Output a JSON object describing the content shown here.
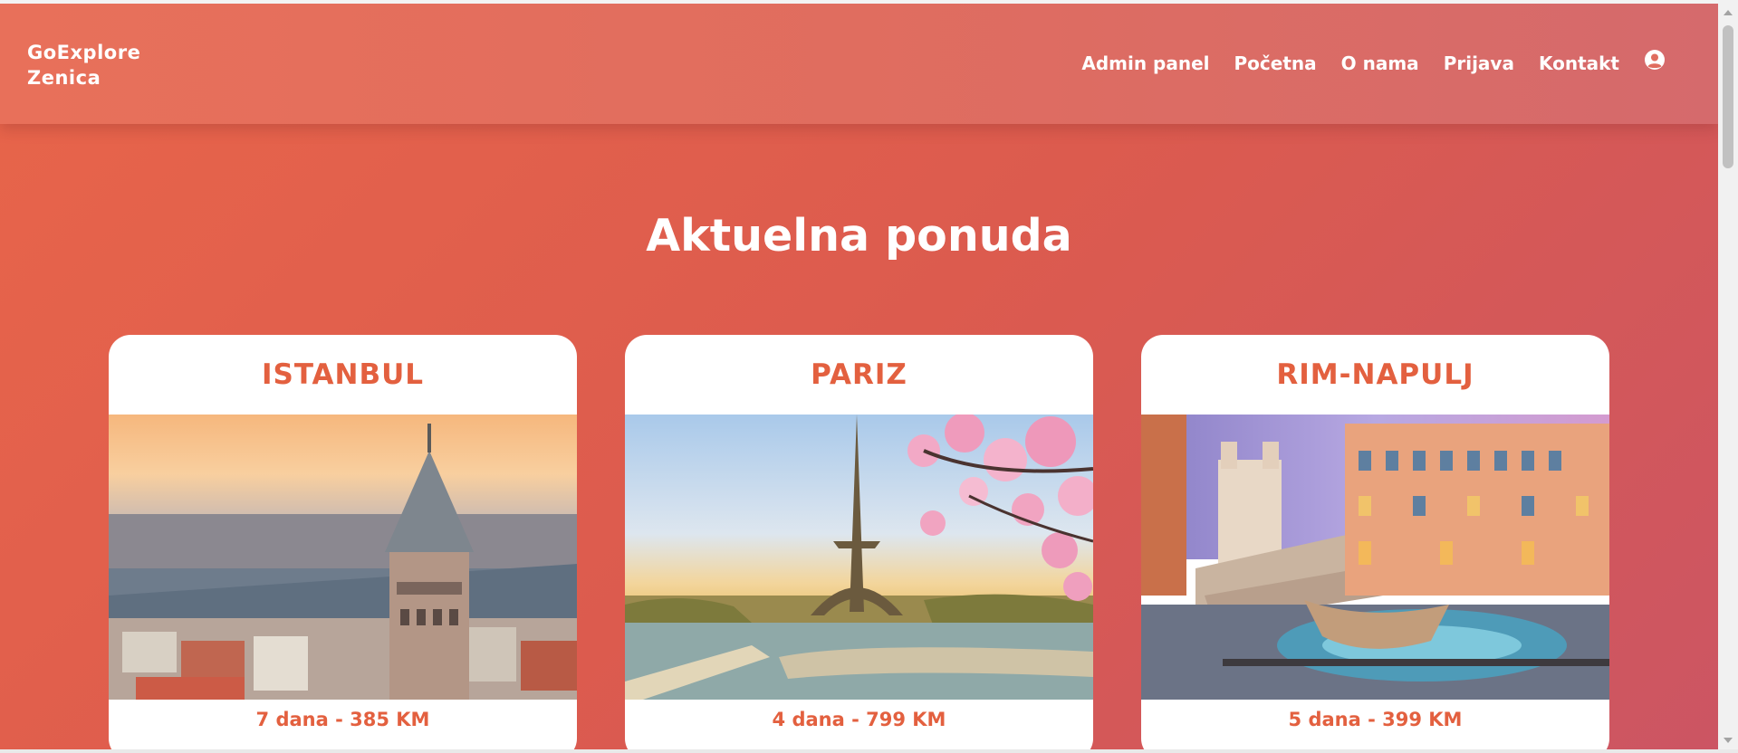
{
  "navbar": {
    "brand_line1": "GoExplore",
    "brand_line2": "Zenica",
    "links": [
      "Admin panel",
      "Početna",
      "O nama",
      "Prijava",
      "Kontakt"
    ],
    "user_icon": "user-circle-icon"
  },
  "main": {
    "title": "Aktuelna ponuda"
  },
  "offers": [
    {
      "title": "ISTANBUL",
      "price": "7 dana - 385 KM",
      "image": "galata-tower-photo"
    },
    {
      "title": "PARIZ",
      "price": "4 dana - 799 KM",
      "image": "eiffel-tower-photo"
    },
    {
      "title": "RIM-NAPULJ",
      "price": "5 dana - 399 KM",
      "image": "spanish-steps-photo"
    }
  ],
  "colors": {
    "accent": "#e3603f",
    "background_start": "#e8654a",
    "background_end": "#cc5563"
  }
}
